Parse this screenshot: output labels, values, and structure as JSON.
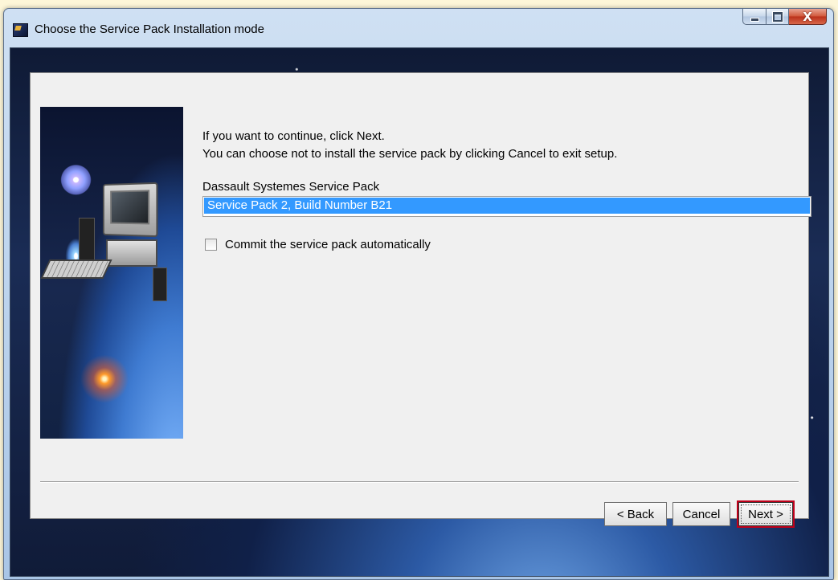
{
  "window": {
    "title": "Choose the Service Pack Installation mode",
    "icons": {
      "app": "setup-app-icon",
      "minimize": "minimize-icon",
      "maximize": "maximize-icon",
      "close": "close-icon"
    },
    "close_glyph": "X"
  },
  "content": {
    "line1": "If you want to continue, click Next.",
    "line2": "You can choose not to install the service pack by clicking Cancel to exit setup.",
    "group_label": "Dassault Systemes Service Pack",
    "list_items": [
      "Service Pack 2, Build Number B21"
    ],
    "checkbox_label": "Commit the service pack automatically",
    "checkbox_checked": false
  },
  "buttons": {
    "back": "< Back",
    "cancel": "Cancel",
    "next": "Next >"
  },
  "colors": {
    "selection": "#3399ff",
    "highlight_border": "#c0001a"
  }
}
